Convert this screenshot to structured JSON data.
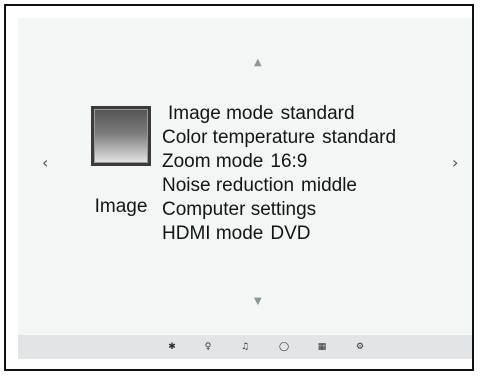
{
  "navigation": {
    "up_glyph": "▲",
    "down_glyph": "▼",
    "left_glyph": "‹",
    "right_glyph": "›"
  },
  "category": {
    "label": "Image",
    "icon": "tv-screen-icon"
  },
  "menu": {
    "items": [
      {
        "name": "Image mode",
        "value": "standard"
      },
      {
        "name": "Color temperature",
        "value": "standard"
      },
      {
        "name": "Zoom mode",
        "value": "16:9"
      },
      {
        "name": "Noise reduction",
        "value": "middle"
      },
      {
        "name": "Computer settings",
        "value": ""
      },
      {
        "name": "HDMI mode",
        "value": "DVD"
      }
    ]
  },
  "bottom_bar": {
    "tabs": [
      {
        "icon": "gear-icon",
        "glyph": "✱"
      },
      {
        "icon": "lightbulb-icon",
        "glyph": "♀"
      },
      {
        "icon": "music-note-icon",
        "glyph": "♫"
      },
      {
        "icon": "clock-icon",
        "glyph": "◯"
      },
      {
        "icon": "grid-icon",
        "glyph": "▦"
      },
      {
        "icon": "settings-icon",
        "glyph": "⚙"
      }
    ]
  }
}
